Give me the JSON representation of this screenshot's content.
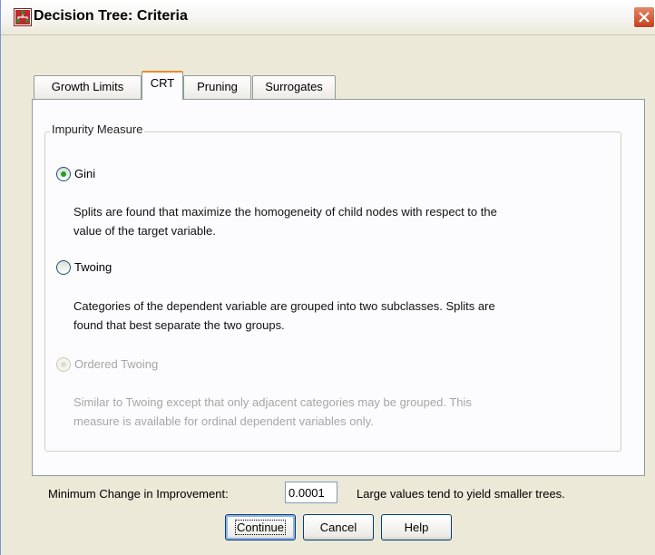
{
  "window": {
    "title": "Decision Tree: Criteria"
  },
  "tabs": [
    {
      "label": "Growth Limits"
    },
    {
      "label": "CRT"
    },
    {
      "label": "Pruning"
    },
    {
      "label": "Surrogates"
    }
  ],
  "active_tab": "CRT",
  "impurity": {
    "legend": "Impurity Measure",
    "options": [
      {
        "label": "Gini",
        "selected": true,
        "enabled": true,
        "desc1": "Splits are found that maximize the homogeneity of child nodes with respect to the",
        "desc2": "value of the target variable."
      },
      {
        "label": "Twoing",
        "selected": false,
        "enabled": true,
        "desc1": "Categories of the dependent variable are grouped into two subclasses. Splits are",
        "desc2": "found that best separate the two groups."
      },
      {
        "label": "Ordered Twoing",
        "selected": false,
        "enabled": false,
        "desc1": "Similar to Twoing except that only adjacent categories may be grouped. This",
        "desc2": "measure is available for ordinal dependent variables only."
      }
    ]
  },
  "min_change": {
    "label": "Minimum Change in Improvement:",
    "value": "0.0001",
    "hint": "Large values tend to yield smaller trees."
  },
  "buttons": {
    "continue": "Continue",
    "cancel": "Cancel",
    "help": "Help"
  },
  "colors": {
    "accent_tab": "#e68b2c",
    "radio_selected": "#21a121",
    "close_button": "#c4401c"
  }
}
